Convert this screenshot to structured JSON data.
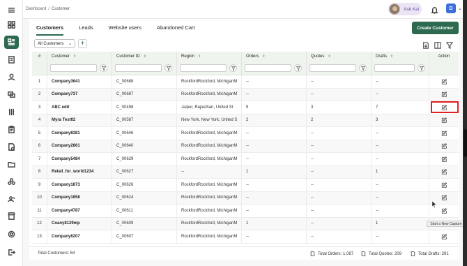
{
  "breadcrumb": {
    "root": "Dashboard",
    "separator": "/",
    "current": "Customer"
  },
  "header": {
    "assistant_label": "Ask Kai",
    "user_initial": "D"
  },
  "tabs": [
    {
      "label": "Customers",
      "active": true
    },
    {
      "label": "Leads",
      "active": false
    },
    {
      "label": "Website users",
      "active": false
    },
    {
      "label": "Abandoned Cart",
      "active": false
    }
  ],
  "create_button": "Create Customer",
  "filter": {
    "selected": "All Customers"
  },
  "add_icon": "plus-icon",
  "table": {
    "columns": [
      "#",
      "Customer",
      "Customer ID",
      "Region",
      "Orders",
      "Quotes",
      "Drafts",
      "Action"
    ],
    "rows": [
      {
        "n": "1",
        "customer": "Company3641",
        "id": "C_00688",
        "region": "RockfordRockford, MichiganM",
        "orders": "--",
        "quotes": "--",
        "drafts": "--"
      },
      {
        "n": "2",
        "customer": "Company737",
        "id": "C_00687",
        "region": "RockfordRockford, MichiganM",
        "orders": "--",
        "quotes": "--",
        "drafts": "--"
      },
      {
        "n": "3",
        "customer": "ABC edit",
        "id": "C_00498",
        "region": "Jaipur, Rajasthan, United St",
        "orders": "9",
        "quotes": "3",
        "drafts": "7"
      },
      {
        "n": "4",
        "customer": "Myra Test02",
        "id": "C_00587",
        "region": "New York, New York, United S",
        "orders": "2",
        "quotes": "2",
        "drafts": "3"
      },
      {
        "n": "5",
        "customer": "Company8381",
        "id": "C_00646",
        "region": "RockfordRockford, MichiganM",
        "orders": "--",
        "quotes": "--",
        "drafts": "--"
      },
      {
        "n": "6",
        "customer": "Company2861",
        "id": "C_00640",
        "region": "RockfordRockford, MichiganM",
        "orders": "--",
        "quotes": "--",
        "drafts": "--"
      },
      {
        "n": "7",
        "customer": "Company5484",
        "id": "C_00629",
        "region": "RockfordRockford, MichiganM",
        "orders": "--",
        "quotes": "--",
        "drafts": "--"
      },
      {
        "n": "8",
        "customer": "Retail_for_world1234",
        "id": "C_00627",
        "region": "--",
        "orders": "1",
        "quotes": "--",
        "drafts": "1"
      },
      {
        "n": "9",
        "customer": "Company1873",
        "id": "C_00626",
        "region": "RockfordRockford, MichiganM",
        "orders": "--",
        "quotes": "--",
        "drafts": "--"
      },
      {
        "n": "10",
        "customer": "Company1858",
        "id": "C_00624",
        "region": "RockfordRockford, MichiganM",
        "orders": "--",
        "quotes": "--",
        "drafts": "--"
      },
      {
        "n": "11",
        "customer": "Company4787",
        "id": "C_00611",
        "region": "RockfordRockford, MichiganM",
        "orders": "--",
        "quotes": "--",
        "drafts": "--"
      },
      {
        "n": "12",
        "customer": "Coany8129mp",
        "id": "C_00609",
        "region": "RockfordRockford, MichiganM",
        "orders": "1",
        "quotes": "--",
        "drafts": "1"
      },
      {
        "n": "13",
        "customer": "Company6207",
        "id": "C_00607",
        "region": "RockfordRockford, MichiganM",
        "orders": "--",
        "quotes": "--",
        "drafts": "--"
      }
    ]
  },
  "tooltip": "Start a New Capture",
  "footer": {
    "total_customers": "Total Customers: 64",
    "total_orders": "Total Orders: 1,087",
    "total_quotes": "Total Quotes: 209",
    "total_drafts": "Total Drafts: 291"
  },
  "colors": {
    "accent": "#2d6a4f",
    "highlight": "#e02020",
    "header_bg": "#f0f4ee"
  }
}
